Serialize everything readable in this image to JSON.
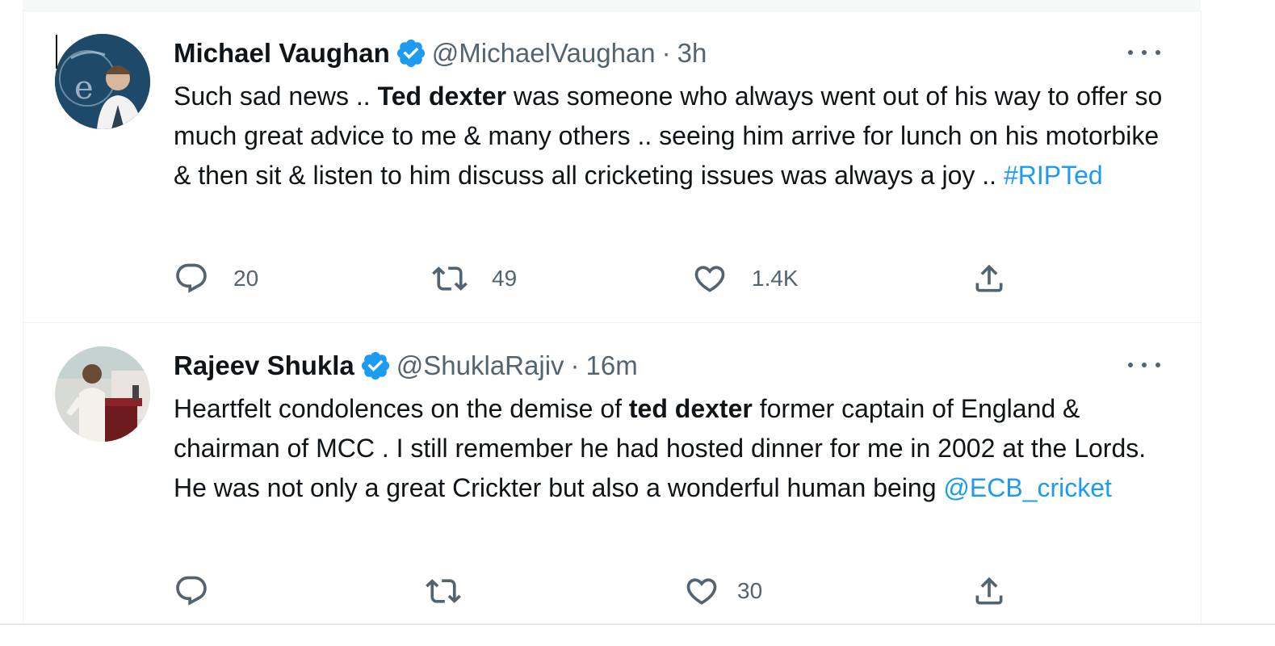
{
  "tweets": [
    {
      "name": "Michael Vaughan",
      "handle": "@MichaelVaughan",
      "separator": "·",
      "time": "3h",
      "text_segments": [
        {
          "text": "Such sad news .. ",
          "style": "plain"
        },
        {
          "text": "Ted dexter",
          "style": "bold"
        },
        {
          "text": " was someone who always went out of his way to offer so much great advice to me & many others .. seeing him arrive for lunch on his motorbike & then sit & listen to him discuss all cricketing issues was always a joy .. ",
          "style": "plain"
        },
        {
          "text": "#RIPTed",
          "style": "link"
        }
      ],
      "actions": {
        "reply": "20",
        "retweet": "49",
        "like": "1.4K",
        "share": ""
      }
    },
    {
      "name": "Rajeev Shukla",
      "handle": "@ShuklaRajiv",
      "separator": "·",
      "time": "16m",
      "text_segments": [
        {
          "text": "Heartfelt condolences on the demise of ",
          "style": "plain"
        },
        {
          "text": "ted dexter",
          "style": "bold"
        },
        {
          "text": " former captain of England & chairman of MCC . I still remember he had hosted dinner for me in 2002 at the Lords. He was not only a great Crickter but also a wonderful human being ",
          "style": "plain"
        },
        {
          "text": "@ECB_cricket",
          "style": "link"
        }
      ],
      "actions": {
        "reply": "",
        "retweet": "",
        "like": "30",
        "share": ""
      }
    }
  ],
  "icons": {
    "verified": "verified-badge-icon",
    "more": "more-options-icon",
    "reply": "reply-icon",
    "retweet": "retweet-icon",
    "like": "heart-icon",
    "share": "share-icon"
  },
  "colors": {
    "text": "#0f1419",
    "secondary": "#536471",
    "link": "#1d9bf0",
    "verified": "#1d9bf0",
    "border": "#eff3f4"
  }
}
